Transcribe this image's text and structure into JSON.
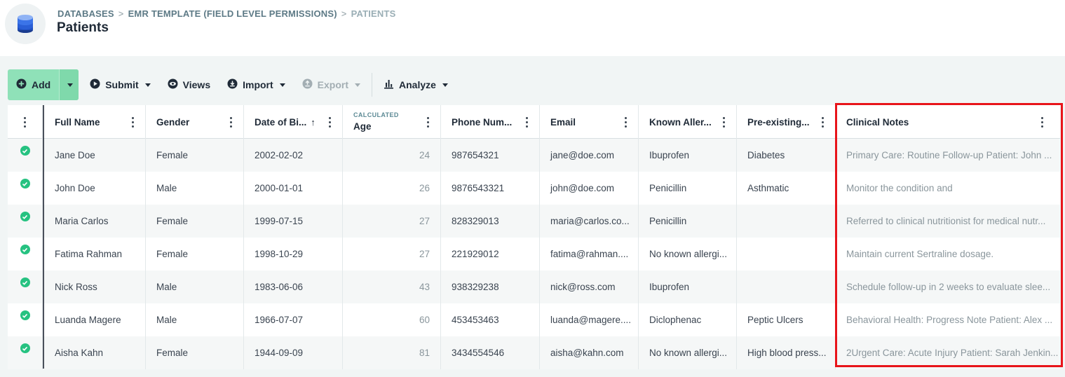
{
  "breadcrumb": {
    "level1": "DATABASES",
    "level2": "EMR TEMPLATE (FIELD LEVEL PERMISSIONS)",
    "level3": "PATIENTS",
    "separator": ">"
  },
  "page_title": "Patients",
  "toolbar": {
    "add": "Add",
    "submit": "Submit",
    "views": "Views",
    "import": "Import",
    "export": "Export",
    "analyze": "Analyze"
  },
  "columns": {
    "full_name": "Full Name",
    "gender": "Gender",
    "dob": "Date of Bi...",
    "age_tag": "CALCULATED",
    "age": "Age",
    "phone": "Phone Num...",
    "email": "Email",
    "allergies": "Known Aller...",
    "preexisting": "Pre-existing...",
    "notes": "Clinical Notes"
  },
  "rows": [
    {
      "name": "Jane Doe",
      "gender": "Female",
      "dob": "2002-02-02",
      "age": "24",
      "phone": "987654321",
      "email": "jane@doe.com",
      "allergies": "Ibuprofen",
      "preexisting": "Diabetes",
      "notes": "Primary Care: Routine Follow-up Patient: John ..."
    },
    {
      "name": "John Doe",
      "gender": "Male",
      "dob": "2000-01-01",
      "age": "26",
      "phone": "9876543321",
      "email": "john@doe.com",
      "allergies": "Penicillin",
      "preexisting": "Asthmatic",
      "notes": "Monitor the condition and"
    },
    {
      "name": "Maria Carlos",
      "gender": "Female",
      "dob": "1999-07-15",
      "age": "27",
      "phone": "828329013",
      "email": "maria@carlos.co...",
      "allergies": "Penicillin",
      "preexisting": "",
      "notes": "Referred to clinical nutritionist for medical nutr..."
    },
    {
      "name": "Fatima Rahman",
      "gender": "Female",
      "dob": "1998-10-29",
      "age": "27",
      "phone": "221929012",
      "email": "fatima@rahman....",
      "allergies": "No known allergi...",
      "preexisting": "",
      "notes": "Maintain current Sertraline dosage."
    },
    {
      "name": "Nick Ross",
      "gender": "Male",
      "dob": "1983-06-06",
      "age": "43",
      "phone": "938329238",
      "email": "nick@ross.com",
      "allergies": "Ibuprofen",
      "preexisting": "",
      "notes": "Schedule follow-up in 2 weeks to evaluate slee..."
    },
    {
      "name": "Luanda Magere",
      "gender": "Male",
      "dob": "1966-07-07",
      "age": "60",
      "phone": "453453463",
      "email": "luanda@magere....",
      "allergies": "Diclophenac",
      "preexisting": "Peptic Ulcers",
      "notes": "Behavioral Health: Progress Note Patient: Alex ..."
    },
    {
      "name": "Aisha Kahn",
      "gender": "Female",
      "dob": "1944-09-09",
      "age": "81",
      "phone": "3434554546",
      "email": "aisha@kahn.com",
      "allergies": "No known allergi...",
      "preexisting": "High blood press...",
      "notes": "2Urgent Care: Acute Injury Patient: Sarah Jenkin..."
    }
  ],
  "colors": {
    "accent_green": "#8fe1b8",
    "status_green": "#26c281",
    "highlight_red": "#e8141a"
  }
}
